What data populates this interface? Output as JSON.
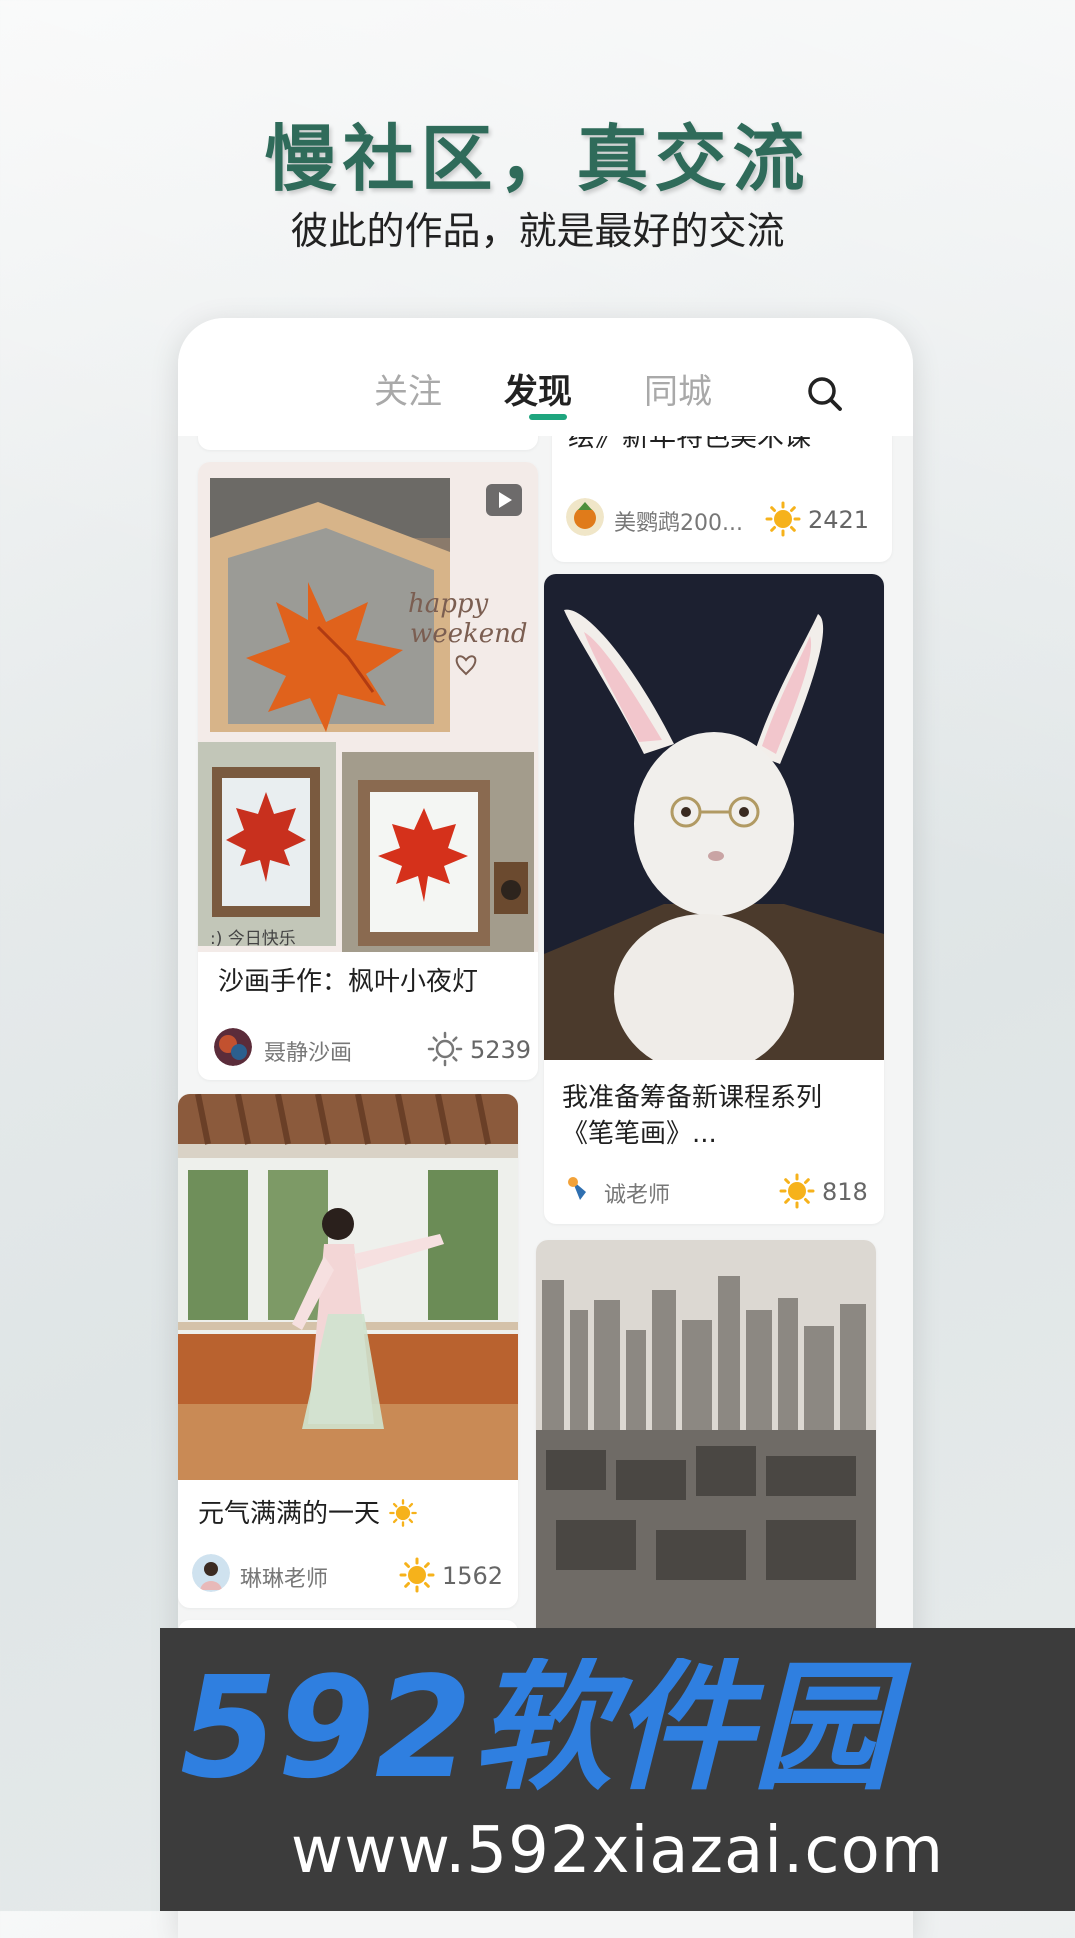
{
  "promo": {
    "headline": "慢社区，真交流",
    "subheadline": "彼此的作品，就是最好的交流"
  },
  "tabs": [
    {
      "label": "关注",
      "active": false
    },
    {
      "label": "发现",
      "active": true
    },
    {
      "label": "同城",
      "active": false
    }
  ],
  "colors": {
    "accent": "#1ea57e",
    "headline": "#2f6b5a",
    "sun": "#f6b21b"
  },
  "feed": {
    "left": [
      {
        "image_text": [
          ":) 今日快乐",
          "happy",
          "weekend"
        ],
        "title": "沙画手作：枫叶小夜灯",
        "author": "聂静沙画",
        "count": "5239",
        "liked": false
      },
      {
        "title": "元气满满的一天",
        "author": "琳琳老师",
        "count": "1562",
        "liked": true
      }
    ],
    "right": [
      {
        "title": "绘》新年特色美术课",
        "author": "美鹦鹉200...",
        "count": "2421",
        "liked": true
      },
      {
        "title_line1": "我准备筹备新课程系列",
        "title_line2": "《笔笔画》...",
        "author": "诚老师",
        "count": "818",
        "liked": true
      }
    ]
  },
  "watermark": {
    "logo_text": "592软件园",
    "url": "www.592xiazai.com"
  }
}
